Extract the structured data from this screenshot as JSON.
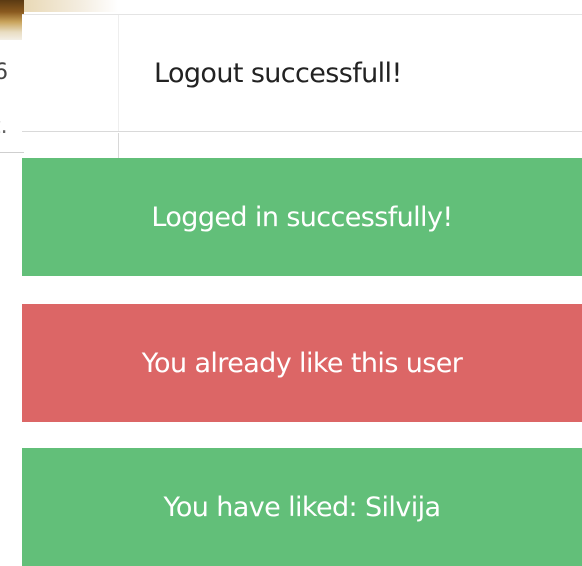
{
  "background": {
    "fragment_text_1": "6",
    "fragment_text_2": "t."
  },
  "toasts": [
    {
      "kind": "info",
      "message": "Logout successfull!",
      "color": "#ffffff"
    },
    {
      "kind": "success",
      "message": "Logged in successfully!",
      "color": "#62bf79"
    },
    {
      "kind": "error",
      "message": "You already like this user",
      "color": "#dc6666"
    },
    {
      "kind": "success",
      "message": "You have liked: Silvija",
      "color": "#62bf79"
    }
  ]
}
